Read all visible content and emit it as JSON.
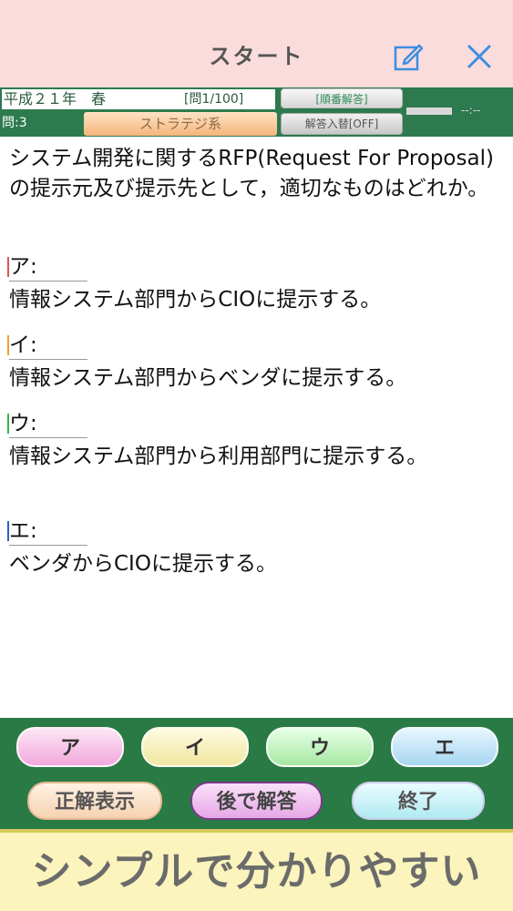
{
  "header": {
    "title": "スタート"
  },
  "info": {
    "era": "平成２１年　春",
    "question_counter": "[問1/100]",
    "question_number": "問:3",
    "category": "ストラテジ系",
    "order_button": "[順番解答]",
    "swap_button": "解答入替[OFF]",
    "timer": "--:--"
  },
  "question": {
    "text": "システム開発に関するRFP(Request For Proposal)の提示元及び提示先として，適切なものはどれか。"
  },
  "choices": [
    {
      "label": "ア:",
      "text": "情報システム部門からCIOに提示する。",
      "mark_color": "#d9534f"
    },
    {
      "label": "イ:",
      "text": "情報システム部門からベンダに提示する。",
      "mark_color": "#f0a030"
    },
    {
      "label": "ウ:",
      "text": "情報システム部門から利用部門に提示する。",
      "mark_color": "#3cb050"
    },
    {
      "label": "エ:",
      "text": "ベンダからCIOに提示する。",
      "mark_color": "#3060c0"
    }
  ],
  "answer_buttons": [
    "ア",
    "イ",
    "ウ",
    "エ"
  ],
  "actions": {
    "show_answer": "正解表示",
    "answer_later": "後で解答",
    "end": "終了"
  },
  "banner": {
    "text": "シンプルで分かりやすい"
  },
  "colors": {
    "header_bg": "#fbdcdc",
    "panel_bg": "#2a7a45",
    "banner_bg": "#fbf4bc"
  }
}
